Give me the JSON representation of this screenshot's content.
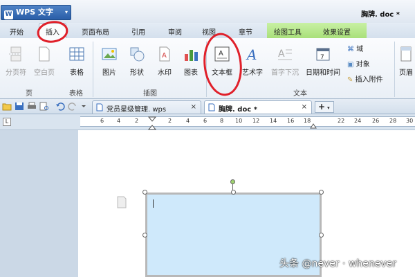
{
  "app": {
    "menu_label": "WPS 文字",
    "logo_glyph": "W",
    "menu_arrow": "▾"
  },
  "window": {
    "doc_title": "胸牌. doc *"
  },
  "tabs": [
    "开始",
    "插入",
    "页面布局",
    "引用",
    "审阅",
    "视图",
    "章节"
  ],
  "context_tabs": [
    "绘图工具",
    "效果设置"
  ],
  "ribbon": {
    "buttons": {
      "page_break": "分页符",
      "blank_page": "空白页",
      "table": "表格",
      "picture": "图片",
      "shape": "形状",
      "watermark": "水印",
      "chart": "图表",
      "textbox": "文本框",
      "wordart": "艺术字",
      "dropcap": "首字下沉",
      "datetime": "日期和时间",
      "domain": "域",
      "object": "对象",
      "attachment": "插入附件",
      "header": "页眉"
    },
    "groups": {
      "page": "页",
      "table": "表格",
      "illustration": "插图",
      "text": "文本"
    }
  },
  "doc_tabs": [
    {
      "label": "党员星级管理. wps",
      "close": "×"
    },
    {
      "label": "胸牌. doc *",
      "close": "×"
    }
  ],
  "new_tab_glyph": "+",
  "ruler_corner": "L",
  "ruler_ticks": [
    "6",
    "4",
    "2",
    "2",
    "4",
    "6",
    "8",
    "10",
    "12",
    "14",
    "16",
    "18",
    "22",
    "24",
    "26",
    "28",
    "30"
  ],
  "watermark_text": "头条 @never · whenever",
  "colors": {
    "accent": "#2a5ea8",
    "annotation": "#e0202a",
    "context_tab": "#a9e07a",
    "textbox_fill": "#cfe9fb"
  }
}
